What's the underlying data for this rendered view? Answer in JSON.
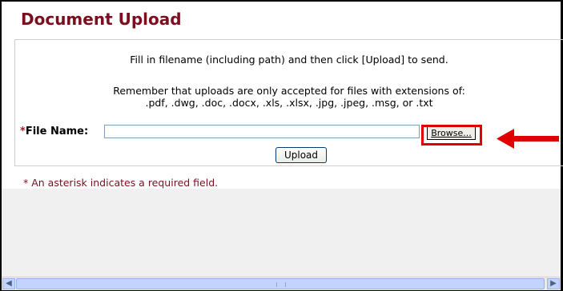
{
  "page": {
    "title": "Document Upload"
  },
  "instructions": {
    "line1": "Fill in filename (including path) and then click [Upload] to send.",
    "line2": "Remember that uploads are only accepted for files with extensions of:",
    "line3": ".pdf, .dwg, .doc, .docx, .xls, .xlsx, .jpg, .jpeg, .msg, or .txt"
  },
  "form": {
    "required_marker": "*",
    "file_label": "File Name:",
    "file_value": "",
    "browse_label": "Browse...",
    "upload_label": "Upload"
  },
  "footnote": "* An asterisk indicates a required field.",
  "annotation": {
    "color": "#e00000"
  },
  "colors": {
    "title": "#7a0f1f",
    "footnote": "#7a0f1f"
  },
  "icons": {
    "scroll_left": "arrow-left-icon",
    "scroll_right": "arrow-right-icon"
  }
}
